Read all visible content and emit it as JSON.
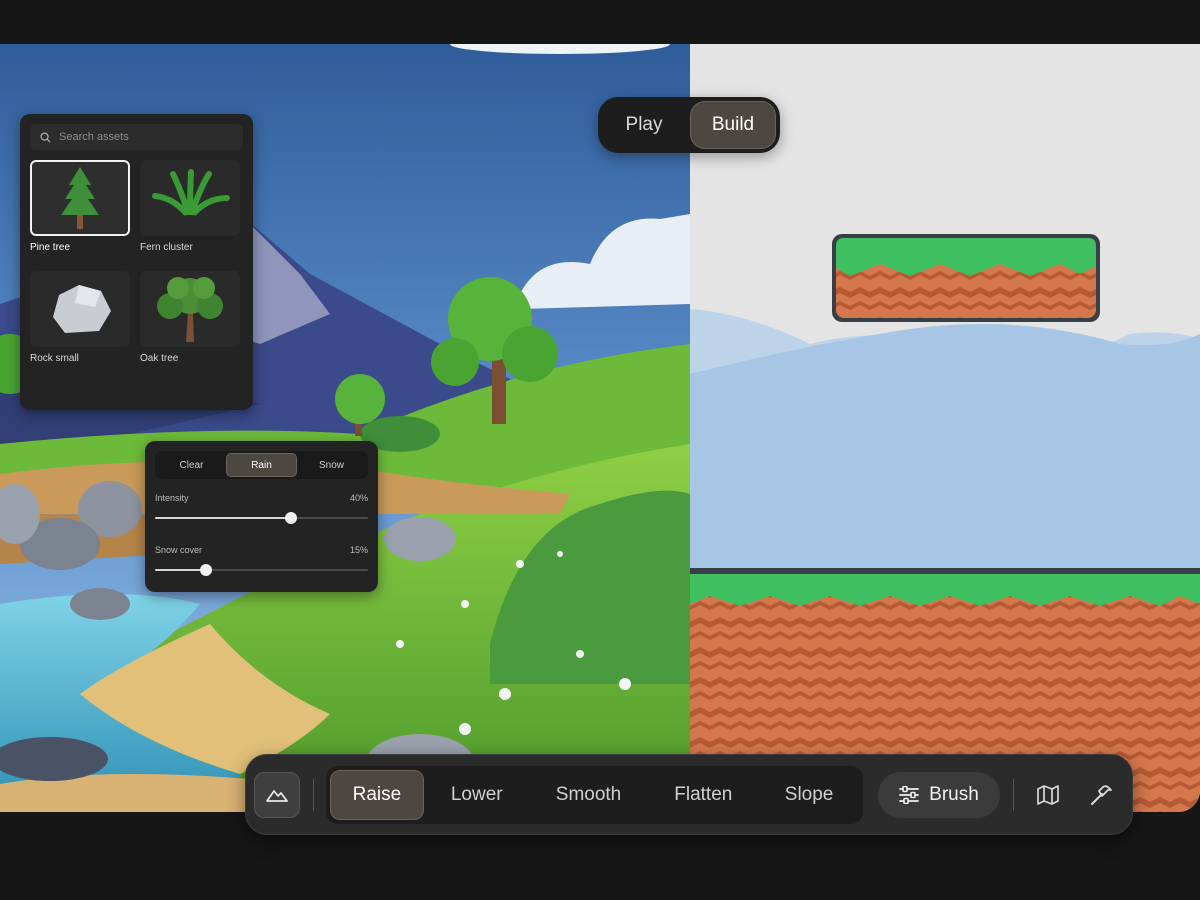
{
  "mode_toggle": {
    "play": "Play",
    "build": "Build",
    "active": "Build"
  },
  "asset_panel": {
    "search_placeholder": "Search assets",
    "assets": [
      {
        "label": "Pine tree",
        "icon": "pine-tree-icon",
        "selected": true
      },
      {
        "label": "Fern cluster",
        "icon": "fern-icon",
        "selected": false
      },
      {
        "label": "Rock small",
        "icon": "rock-icon",
        "selected": false
      },
      {
        "label": "Oak tree",
        "icon": "oak-tree-icon",
        "selected": false
      }
    ]
  },
  "weather_panel": {
    "options": [
      "Clear",
      "Rain",
      "Snow"
    ],
    "active": "Rain",
    "sliders": [
      {
        "label": "Intensity",
        "value_text": "40%",
        "value": 40
      },
      {
        "label": "Snow cover",
        "value_text": "15%",
        "value": 15
      }
    ]
  },
  "toolbar": {
    "terrain_icon": "mountain-icon",
    "tools": [
      "Raise",
      "Lower",
      "Smooth",
      "Flatten",
      "Slope"
    ],
    "active_tool": "Raise",
    "brush_label": "Brush",
    "brush_icon": "sliders-icon",
    "map_icon": "map-icon",
    "hammer_icon": "hammer-icon"
  },
  "colors": {
    "panel_bg": "#232323",
    "active_segment": "#4d4741",
    "grass_green": "#3fc060",
    "dirt_orange": "#d5774c",
    "sky_2d": "#e4e4e4"
  }
}
